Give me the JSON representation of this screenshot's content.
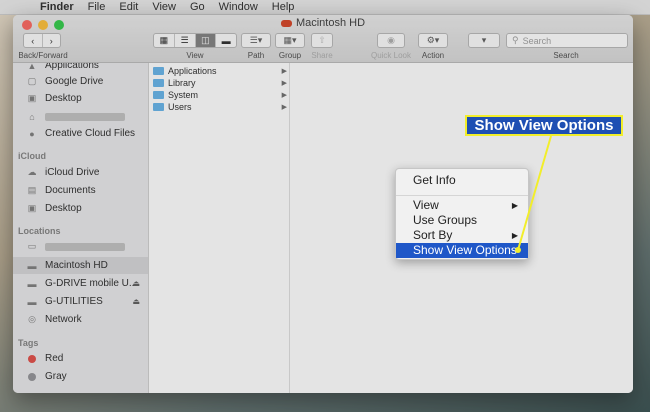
{
  "menubar": {
    "app": "Finder",
    "items": [
      "File",
      "Edit",
      "View",
      "Go",
      "Window",
      "Help"
    ]
  },
  "window": {
    "title": "Macintosh HD",
    "toolbar": {
      "back_forward_label": "Back/Forward",
      "view_label": "View",
      "path_label": "Path",
      "group_label": "Group",
      "share_label": "Share",
      "quicklook_label": "Quick Look",
      "action_label": "Action",
      "search_label": "Search",
      "search_placeholder": "Search"
    }
  },
  "sidebar": {
    "top_items": [
      "Applications",
      "Google Drive",
      "Desktop",
      "",
      "Creative Cloud Files"
    ],
    "icloud_header": "iCloud",
    "icloud_items": [
      "iCloud Drive",
      "Documents",
      "Desktop"
    ],
    "locations_header": "Locations",
    "location_items": [
      "",
      "Macintosh HD",
      "G-DRIVE mobile U...",
      "G-UTILITIES",
      "Network"
    ],
    "tags_header": "Tags",
    "tags": [
      {
        "name": "Red",
        "color": "#e0443e"
      },
      {
        "name": "Gray",
        "color": "#8e8e93"
      }
    ]
  },
  "columns": {
    "folders": [
      "Applications",
      "Library",
      "System",
      "Users"
    ]
  },
  "context_menu": {
    "items": [
      "Get Info",
      "View",
      "Use Groups",
      "Sort By",
      "Show View Options"
    ],
    "highlighted": "Show View Options",
    "highlight_color": "#1f57c8"
  },
  "callout": {
    "text": "Show View Options",
    "fill": "#1e4fb3",
    "border": "#f2ee2a"
  }
}
